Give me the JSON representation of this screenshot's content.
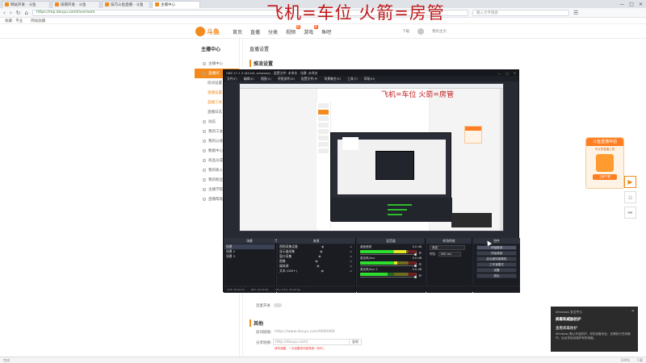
{
  "browser": {
    "tabs": [
      {
        "label": "网站开发 - 斗鱼"
      },
      {
        "label": "排期开发 - 斗鱼"
      },
      {
        "label": "技巧斗鱼直播 - 斗鱼"
      },
      {
        "label": "主播中心"
      }
    ],
    "window_controls": [
      "—",
      "□",
      "✕"
    ],
    "url": "https://mp.douyu.com/live/room",
    "search_placeholder": "输入文字搜索",
    "bookmarks": [
      "收藏 · 专业",
      "网站收藏"
    ]
  },
  "overlay_title": "飞机=车位 火箭=房管",
  "site": {
    "logo_text": "斗鱼",
    "nav": [
      {
        "label": "首页",
        "badge": ""
      },
      {
        "label": "直播",
        "badge": ""
      },
      {
        "label": "分类",
        "badge": ""
      },
      {
        "label": "视频",
        "badge": "新"
      },
      {
        "label": "游戏",
        "badge": "新"
      },
      {
        "label": "鱼吧",
        "badge": ""
      }
    ],
    "header_right": [
      "下载",
      "我的主页"
    ]
  },
  "sidebar": {
    "title": "主播中心",
    "items": [
      {
        "label": "主播中心",
        "active": false
      },
      {
        "label": "直播间",
        "active": true
      }
    ],
    "subitems": [
      {
        "label": "房间设置",
        "plain": true
      },
      {
        "label": "直播设置",
        "plain": false
      },
      {
        "label": "直播工具",
        "plain": false
      },
      {
        "label": "直播日志",
        "plain": true
      }
    ],
    "more_items": [
      "动态",
      "我的工会",
      "我的公会",
      "数据中心",
      "商品分成",
      "我的收入",
      "我的粉丝",
      "主播学院",
      "直播帮助"
    ]
  },
  "main": {
    "breadcrumb": "直播设置",
    "section1_title": "推流设置",
    "toggle_label": "连麦开关",
    "section2_title": "其他",
    "room_link_label": "房间链接:",
    "room_link_value": "https://www.douyu.com/9000466",
    "share_label": "分享链接:",
    "share_value": "http://douyu.com/",
    "copy_label": "复制",
    "warning_text": "请勿泄露，一旦泄露将可能导致一系列..."
  },
  "promo": {
    "title": "斗鱼直播伴侣",
    "subtitle": "专业的直播工具",
    "button": "立即下载"
  },
  "float_icons": [
    "play-icon",
    "home-icon",
    "share-icon"
  ],
  "toast": {
    "app": "Windows 安全中心",
    "title": "病毒和威胁防护",
    "heading": "查看病毒防护",
    "body": "Windows 默认开启防护。你的设备安全，无需执行任何操作，后台将自动保护你的电脑。",
    "close": "✕"
  },
  "statusbar": {
    "left": "完成",
    "right": [
      "100%",
      "下载"
    ]
  },
  "obs": {
    "title": "OBS 27.1.3 (64-bit, windows) - 配置文件: 未命名 - 场景: 未命名",
    "menu": [
      "文件(F)",
      "编辑(E)",
      "视图(V)",
      "停靠部件(D)",
      "配置文件(P)",
      "场景集合(S)",
      "工具(T)",
      "帮助(H)"
    ],
    "docks": {
      "scenes_head": "场景",
      "sources_head": "来源",
      "mixer_head": "混音器",
      "transitions_head": "转场特效",
      "controls_head": "控件"
    },
    "scene_tabs": [
      "节目",
      "预览"
    ],
    "scenes": [
      {
        "label": "场景",
        "selected": true
      },
      {
        "label": "场景 2",
        "selected": false
      },
      {
        "label": "场景 3",
        "selected": false
      }
    ],
    "sources": [
      {
        "label": "视频采集设备",
        "selected": false
      },
      {
        "label": "显示器采集",
        "selected": false
      },
      {
        "label": "窗口采集",
        "selected": false
      },
      {
        "label": "图像",
        "selected": false
      },
      {
        "label": "媒体源",
        "selected": false
      },
      {
        "label": "文本 (GDI+)",
        "selected": false
      }
    ],
    "mixer": [
      {
        "name": "桌面音频",
        "db": "0.0 dB",
        "level": 0.82,
        "volume": 1.0
      },
      {
        "name": "麦克风/Aux",
        "db": "0.0 dB",
        "level": 0.66,
        "volume": 1.0
      },
      {
        "name": "麦克风/Aux 2",
        "db": "0.0 dB",
        "level": 0.48,
        "volume": 1.0
      }
    ],
    "transition_type": "渐变",
    "duration_label": "时长",
    "duration_value": "300 ms",
    "controls": [
      "开始推流",
      "开始录制",
      "启动虚拟摄像机",
      "工作室模式",
      "设置",
      "退出"
    ],
    "status": [
      "LIVE: 00:00:00",
      "REC: 00:00:00",
      "CPU: 2.6%, 30.00 fps"
    ]
  }
}
